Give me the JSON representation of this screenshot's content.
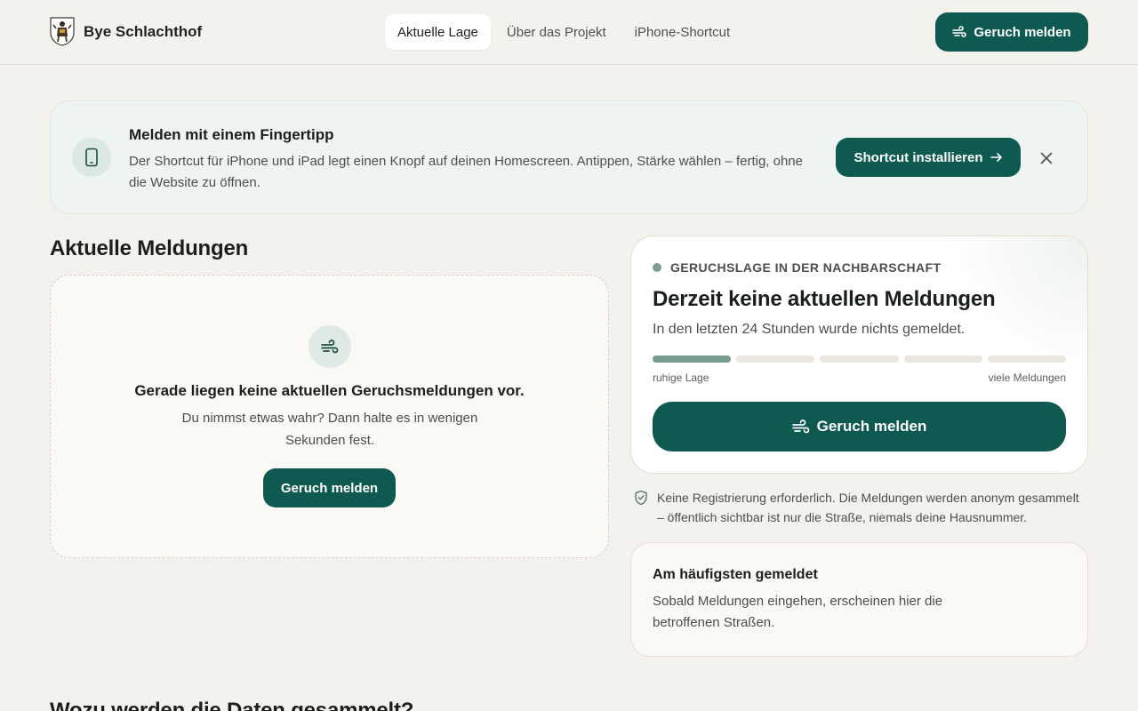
{
  "header": {
    "brand_name": "Bye Schlachthof",
    "nav": [
      {
        "label": "Aktuelle Lage",
        "active": true
      },
      {
        "label": "Über das Projekt",
        "active": false
      },
      {
        "label": "iPhone-Shortcut",
        "active": false
      }
    ],
    "report_button": "Geruch melden"
  },
  "banner": {
    "icon": "phone-icon",
    "title": "Melden mit einem Fingertipp",
    "text": "Der Shortcut für iPhone und iPad legt einen Knopf auf deinen Homescreen. Antippen, Stärke wählen – fertig, ohne die Website zu öffnen.",
    "button": "Shortcut installieren"
  },
  "reports": {
    "title": "Aktuelle Meldungen",
    "empty_title": "Gerade liegen keine aktuellen Geruchsmeldungen vor.",
    "empty_text": "Du nimmst etwas wahr? Dann halte es in wenigen Sekunden fest.",
    "empty_button": "Geruch melden"
  },
  "status": {
    "label": "GERUCHSLAGE IN DER NACHBARSCHAFT",
    "headline": "Derzeit keine aktuellen Meldungen",
    "subtext": "In den letzten 24 Stunden wurde nichts gemeldet.",
    "level": 1,
    "level_max": 5,
    "level_min_label": "ruhige Lage",
    "level_max_label": "viele Meldungen",
    "button": "Geruch melden"
  },
  "privacy_note": "Keine Registrierung erforderlich. Die Meldungen werden anonym gesammelt – öffentlich sichtbar ist nur die Straße, niemals deine Hausnummer.",
  "top_streets": {
    "title": "Am häufigsten gemeldet",
    "text": "Sobald Meldungen eingehen, erscheinen hier die betroffenen Straßen."
  },
  "next_section_title": "Wozu werden die Daten gesammelt?",
  "colors": {
    "primary": "#0f5a50",
    "background": "#f4f2ed",
    "level_filled": "#779b8c"
  }
}
